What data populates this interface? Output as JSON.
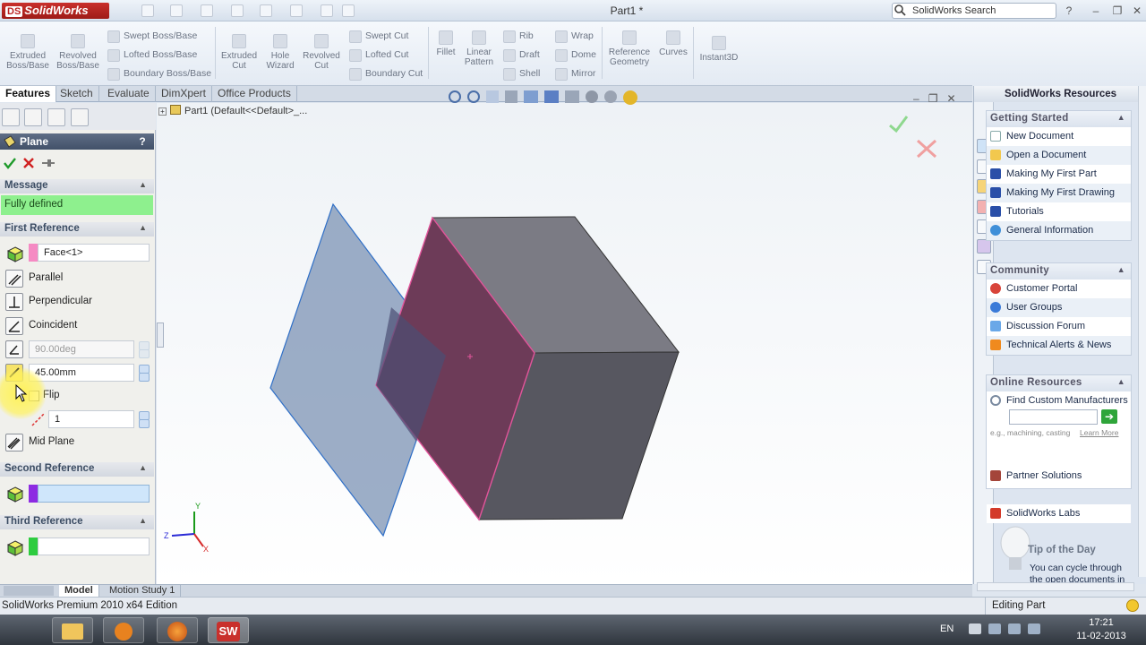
{
  "app": {
    "logo_text": "SolidWorks",
    "doc_title": "Part1 *",
    "search_placeholder": "SolidWorks Search"
  },
  "ribbon": {
    "large": [
      {
        "label": "Extruded\nBoss/Base"
      },
      {
        "label": "Revolved\nBoss/Base"
      },
      {
        "label": "Extruded\nCut"
      },
      {
        "label": "Hole\nWizard"
      },
      {
        "label": "Revolved\nCut"
      },
      {
        "label": "Fillet"
      },
      {
        "label": "Linear\nPattern"
      },
      {
        "label": "Reference\nGeometry"
      },
      {
        "label": "Curves"
      },
      {
        "label": "Instant3D"
      }
    ],
    "small": {
      "swept_boss": "Swept Boss/Base",
      "lofted_boss": "Lofted Boss/Base",
      "boundary_boss": "Boundary Boss/Base",
      "swept_cut": "Swept Cut",
      "lofted_cut": "Lofted Cut",
      "boundary_cut": "Boundary Cut",
      "rib": "Rib",
      "draft": "Draft",
      "shell": "Shell",
      "wrap": "Wrap",
      "dome": "Dome",
      "mirror": "Mirror"
    }
  },
  "tabs": [
    "Features",
    "Sketch",
    "Evaluate",
    "DimXpert",
    "Office Products"
  ],
  "tree": {
    "root": "Part1  (Default<<Default>_..."
  },
  "pm": {
    "title": "Plane",
    "help": "?",
    "message_header": "Message",
    "message": "Fully defined",
    "first_ref_header": "First Reference",
    "first_ref_value": "Face<1>",
    "parallel": "Parallel",
    "perpendicular": "Perpendicular",
    "coincident": "Coincident",
    "angle": "90.00deg",
    "distance": "45.00mm",
    "flip": "Flip",
    "count": "1",
    "mid_plane": "Mid Plane",
    "second_ref_header": "Second Reference",
    "third_ref_header": "Third Reference"
  },
  "taskpane": {
    "title": "SolidWorks Resources",
    "getting_started": {
      "header": "Getting Started",
      "items": [
        "New Document",
        "Open a Document",
        "Making My First Part",
        "Making My First Drawing",
        "Tutorials",
        "General Information"
      ]
    },
    "community": {
      "header": "Community",
      "items": [
        "Customer Portal",
        "User Groups",
        "Discussion Forum",
        "Technical Alerts & News"
      ]
    },
    "online": {
      "header": "Online Resources",
      "find": "Find Custom Manufacturers",
      "hint": "e.g., machining, casting",
      "learn_more": "Learn More",
      "items": [
        "Partner Solutions",
        "SolidWorks Labs"
      ]
    },
    "tip": {
      "header": "Tip of the Day",
      "text": "You can cycle through the open documents in"
    }
  },
  "bottom_tabs": [
    "Model",
    "Motion Study 1"
  ],
  "status": {
    "left": "SolidWorks Premium 2010 x64 Edition",
    "right": "Editing Part"
  },
  "taskbar": {
    "lang": "EN",
    "time": "17:21",
    "date": "11-02-2013"
  },
  "triad": {
    "x": "X",
    "y": "Y",
    "z": "Z"
  },
  "colors": {
    "face_highlight": "#cc3d7a",
    "plane": "#7c93b4",
    "message_bg": "#8ef08e",
    "header_bg": "#4e5d76"
  }
}
